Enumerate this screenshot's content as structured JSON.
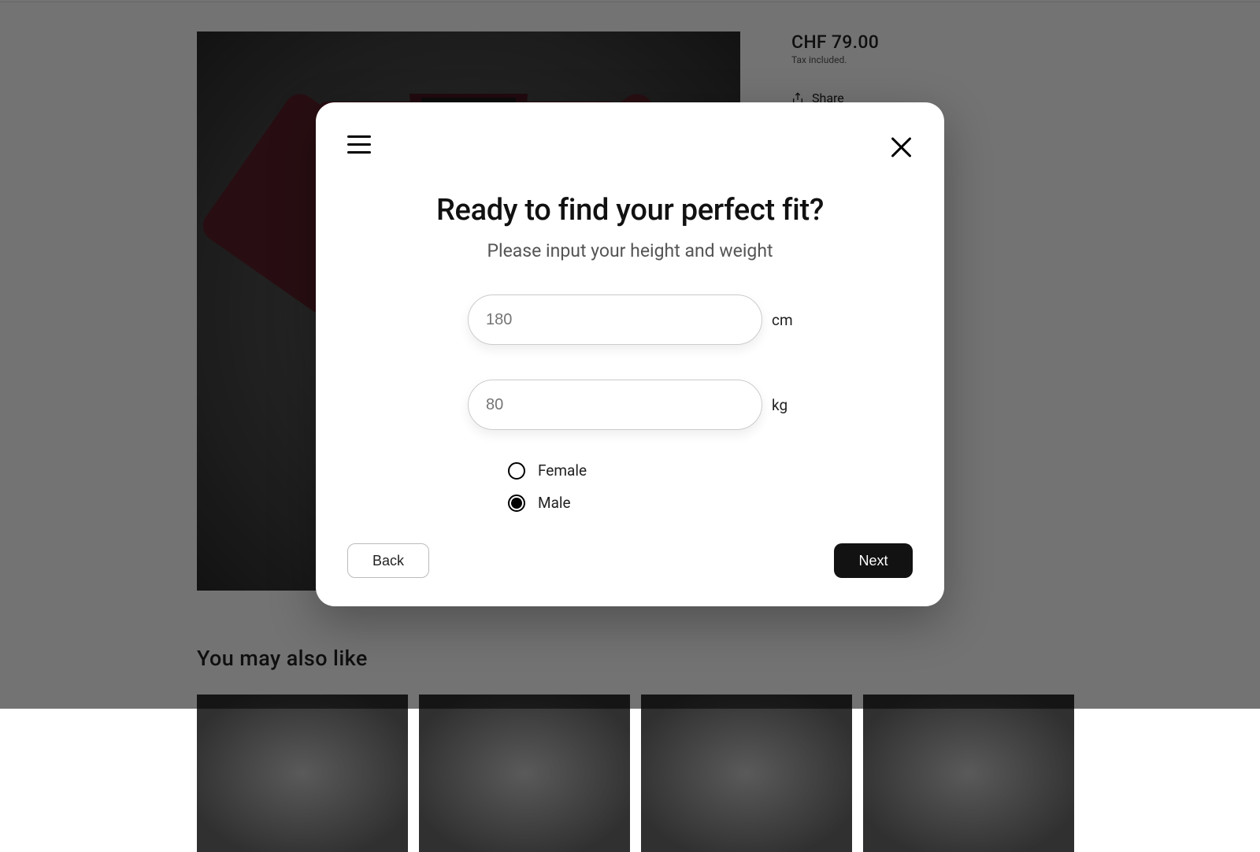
{
  "product": {
    "price": "CHF 79.00",
    "tax_note": "Tax included.",
    "share_label": "Share"
  },
  "recommended": {
    "title": "You may also like"
  },
  "modal": {
    "title": "Ready to find your perfect fit?",
    "subtitle": "Please input your height and weight",
    "height_placeholder": "180",
    "height_unit": "cm",
    "weight_placeholder": "80",
    "weight_unit": "kg",
    "gender_female": "Female",
    "gender_male": "Male",
    "selected_gender": "male",
    "back_label": "Back",
    "next_label": "Next"
  }
}
